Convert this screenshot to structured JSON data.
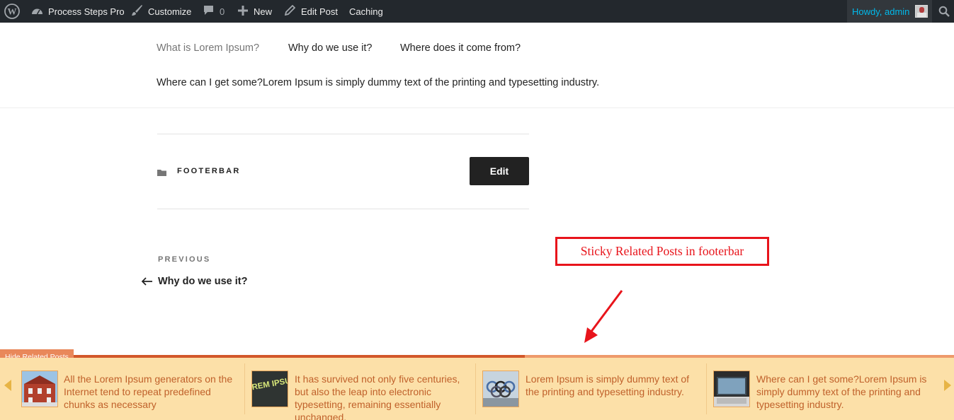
{
  "admin_bar": {
    "site_name": "Process Steps Pro",
    "customize": "Customize",
    "comments_count": "0",
    "new_label": "New",
    "edit_post": "Edit Post",
    "caching": "Caching",
    "howdy": "Howdy, admin",
    "accent_color": "#00b9eb"
  },
  "content": {
    "links": [
      "What is Lorem Ipsum?",
      "Why do we use it?",
      "Where does it come from?"
    ],
    "paragraph": "Where can I get some?Lorem Ipsum is simply dummy text of the printing and typesetting industry.",
    "category": "FOOTERBAR",
    "edit_button": "Edit",
    "previous_label": "PREVIOUS",
    "previous_title": "Why do we use it?"
  },
  "annotation": {
    "text": "Sticky Related Posts in footerbar",
    "color": "#e8141b"
  },
  "footerbar": {
    "hide_button": "Hide Related Posts",
    "thumb_text": "LOREM IPSUM",
    "background": "#fce0a8",
    "accent": "#d2582a",
    "items": [
      {
        "text": "All the Lorem Ipsum generators on the Internet tend to repeat predefined chunks as necessary",
        "thumb_icon": "building-photo"
      },
      {
        "text": "It has survived not only five centuries, but also the leap into electronic typesetting, remaining essentially unchanged.",
        "thumb_icon": "lorem-ipsum-photo"
      },
      {
        "text": "Lorem Ipsum is simply dummy text of the printing and typesetting industry.",
        "thumb_icon": "olympic-rings-photo"
      },
      {
        "text": "Where can I get some?Lorem Ipsum is simply dummy text of the printing and typesetting industry.",
        "thumb_icon": "laptop-photo"
      }
    ]
  }
}
